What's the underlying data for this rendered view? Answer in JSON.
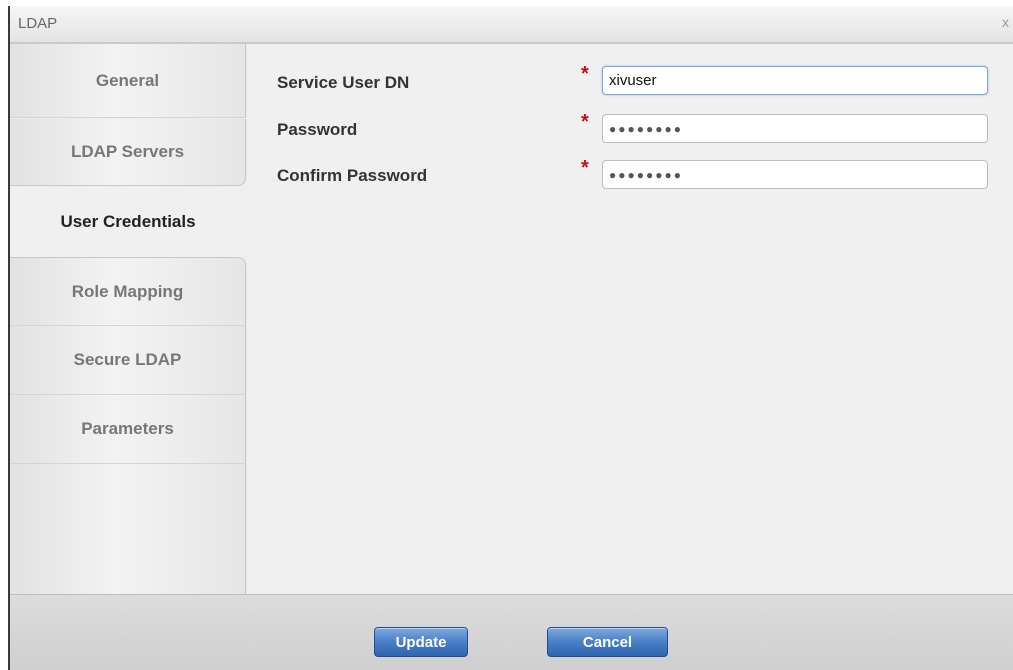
{
  "dialog": {
    "title": "LDAP",
    "close_label": "x"
  },
  "sidebar": {
    "items": [
      {
        "label": "General"
      },
      {
        "label": "LDAP Servers"
      },
      {
        "label": "User Credentials",
        "selected": true
      },
      {
        "label": "Role Mapping"
      },
      {
        "label": "Secure LDAP"
      },
      {
        "label": "Parameters"
      }
    ]
  },
  "form": {
    "required_marker": "*",
    "service_user_dn": {
      "label": "Service User DN",
      "value": "xivuser"
    },
    "password": {
      "label": "Password",
      "value": "●●●●●●●●"
    },
    "confirm_password": {
      "label": "Confirm Password",
      "value": "●●●●●●●●"
    }
  },
  "footer": {
    "update_label": "Update",
    "cancel_label": "Cancel"
  },
  "colors": {
    "button_blue": "#3a72bf",
    "required_red": "#c0141b"
  }
}
